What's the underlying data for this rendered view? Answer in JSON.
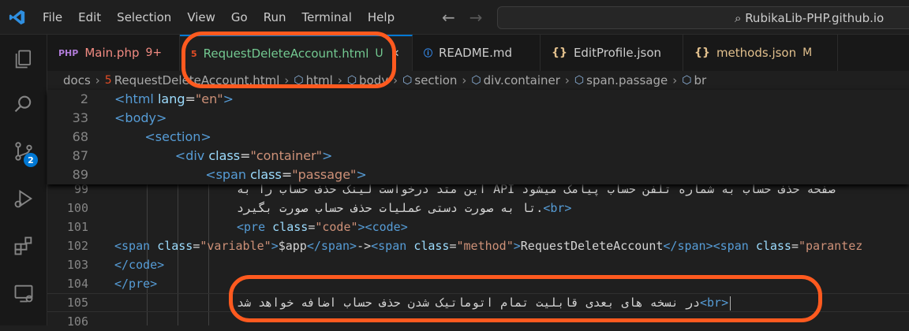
{
  "titlebar": {
    "menu": [
      "File",
      "Edit",
      "Selection",
      "View",
      "Go",
      "Run",
      "Terminal",
      "Help"
    ],
    "command_center": "RubikaLib-PHP.github.io"
  },
  "activity": {
    "scm_badge": "2"
  },
  "tabs": [
    {
      "label": "Main.php",
      "status": "9+",
      "icon": "php",
      "color": "#f28b82"
    },
    {
      "label": "RequestDeleteAccount.html",
      "status": "U",
      "icon": "html",
      "color": "#73c991",
      "active": true
    },
    {
      "label": "README.md",
      "status": "",
      "icon": "info",
      "color": "#cccccc"
    },
    {
      "label": "EditProfile.json",
      "status": "",
      "icon": "{}",
      "color": "#cccccc"
    },
    {
      "label": "methods.json",
      "status": "M",
      "icon": "{}",
      "color": "#e2c08d"
    }
  ],
  "breadcrumb": [
    "docs",
    "RequestDeleteAccount.html",
    "html",
    "body",
    "section",
    "div.container",
    "span.passage",
    "br"
  ],
  "sticky": [
    {
      "n": "2",
      "indent": "",
      "parts": [
        [
          "tg",
          "<html "
        ],
        [
          "at",
          "lang"
        ],
        [
          "tx",
          "="
        ],
        [
          "sv",
          "\"en\""
        ],
        [
          "tg",
          ">"
        ]
      ]
    },
    {
      "n": "33",
      "indent": "",
      "parts": [
        [
          "tg",
          "<body>"
        ]
      ]
    },
    {
      "n": "68",
      "indent": "    ",
      "parts": [
        [
          "tg",
          "<section>"
        ]
      ]
    },
    {
      "n": "87",
      "indent": "        ",
      "parts": [
        [
          "tg",
          "<div "
        ],
        [
          "at",
          "class"
        ],
        [
          "tx",
          "="
        ],
        [
          "sv",
          "\"container\""
        ],
        [
          "tg",
          ">"
        ]
      ]
    },
    {
      "n": "89",
      "indent": "            ",
      "parts": [
        [
          "tg",
          "<span "
        ],
        [
          "at",
          "class"
        ],
        [
          "tx",
          "="
        ],
        [
          "sv",
          "\"passage\""
        ],
        [
          "tg",
          ">"
        ]
      ]
    }
  ],
  "lines": [
    {
      "n": "99",
      "rtl": "صفحه حذف حساب به شماره تلفن حساب پیامک میشود API این متد درخواست لینک حذف حساب را به",
      "tail": ""
    },
    {
      "n": "100",
      "rtl": ".تا به صورت دستی عملیات حذف حساب صورت بگیرد",
      "tail": "<br>"
    },
    {
      "n": "101",
      "code": "pre_code"
    },
    {
      "n": "102",
      "code": "span_line"
    },
    {
      "n": "103",
      "code": "close_code"
    },
    {
      "n": "104",
      "code": "close_pre"
    },
    {
      "n": "105",
      "rtl": "در نسخه های بعدی قابلیت تمام اتوماتیک شدن حذف حساب اضافه خواهد شد",
      "tail": "<br>"
    },
    {
      "n": "106",
      "rtl": "",
      "tail": ""
    }
  ],
  "code_lines": {
    "pre_code": "<pre class=\"code\"><code>",
    "span_line_var": "$app",
    "span_line_method": "RequestDeleteAccount",
    "close_code": "</code>",
    "close_pre": "</pre>"
  }
}
